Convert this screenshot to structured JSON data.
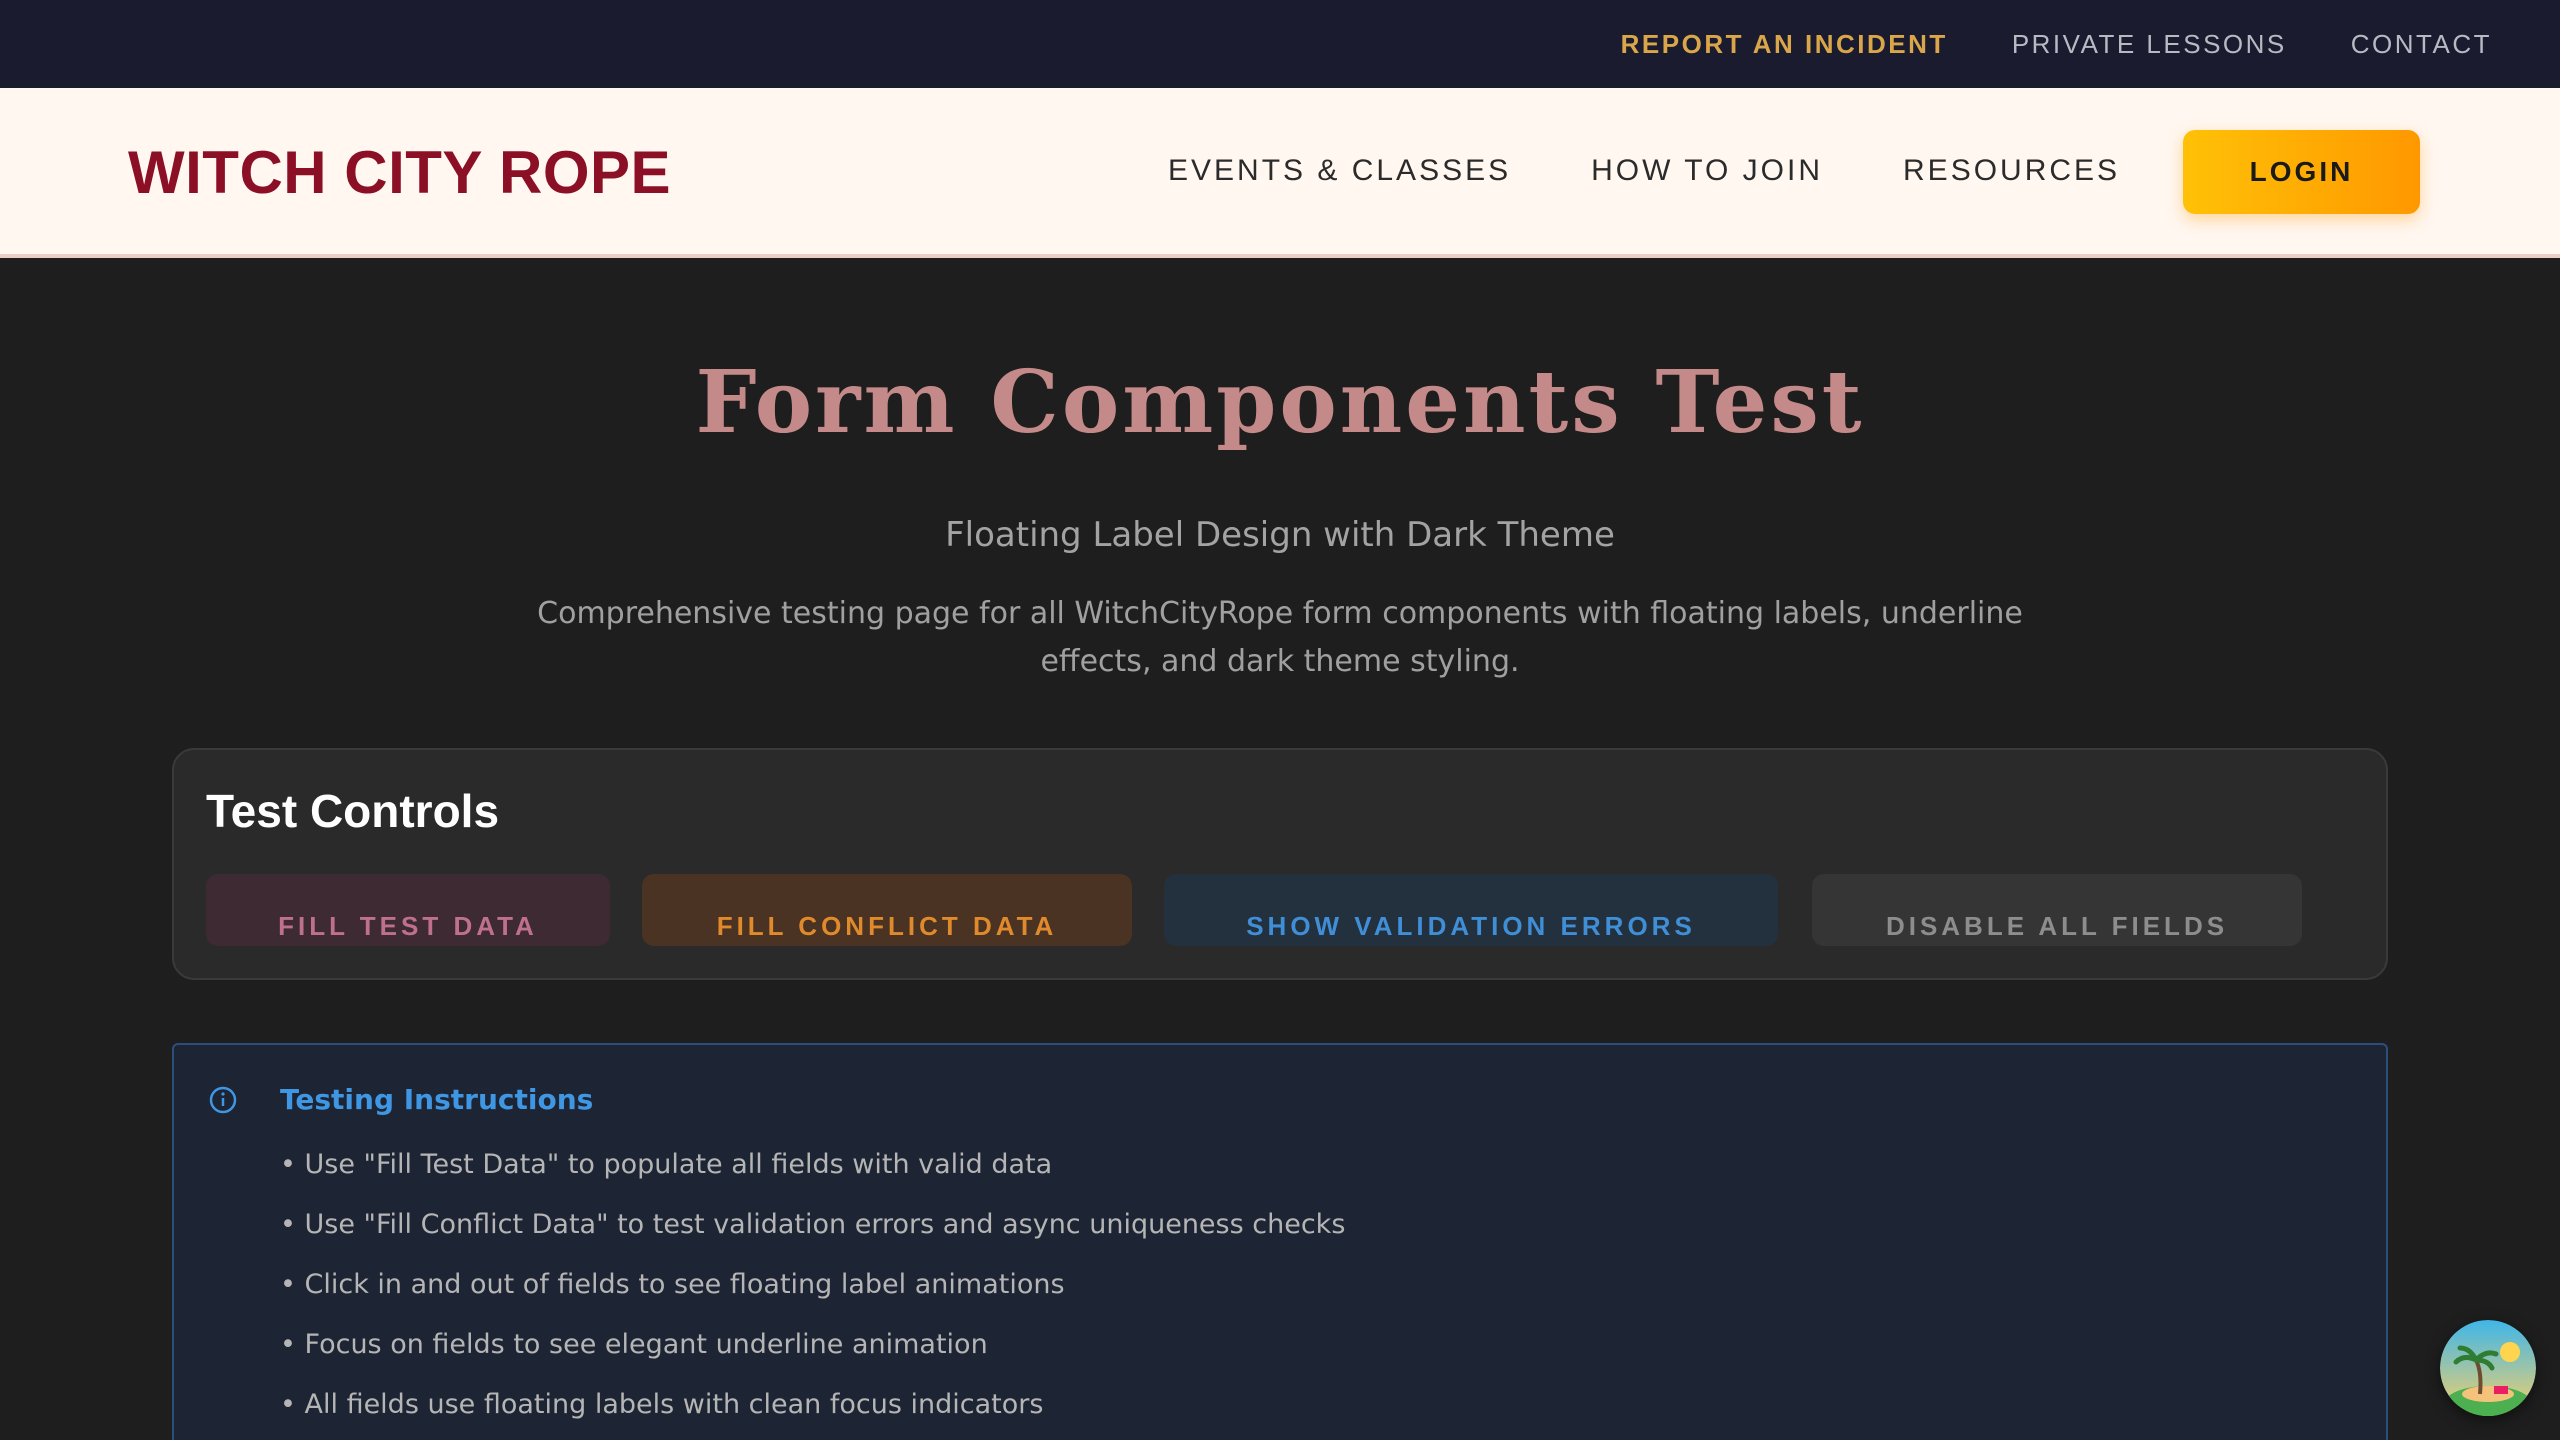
{
  "utility_nav": {
    "incident": "REPORT AN INCIDENT",
    "lessons": "PRIVATE LESSONS",
    "contact": "CONTACT"
  },
  "header": {
    "logo": "WITCH CITY ROPE",
    "nav": [
      "EVENTS & CLASSES",
      "HOW TO JOIN",
      "RESOURCES"
    ],
    "login": "LOGIN"
  },
  "hero": {
    "title": "Form Components Test",
    "subtitle": "Floating Label Design with Dark Theme",
    "description": "Comprehensive testing page for all WitchCityRope form components with floating labels, underline effects, and dark theme styling."
  },
  "controls": {
    "title": "Test Controls",
    "buttons": [
      "FILL TEST DATA",
      "FILL CONFLICT DATA",
      "SHOW VALIDATION ERRORS",
      "DISABLE ALL FIELDS"
    ]
  },
  "instructions": {
    "icon": "info-circle-icon",
    "title": "Testing Instructions",
    "items": [
      "• Use \"Fill Test Data\" to populate all fields with valid data",
      "• Use \"Fill Conflict Data\" to test validation errors and async uniqueness checks",
      "• Click in and out of fields to see floating label animations",
      "• Focus on fields to see elegant underline animation",
      "• All fields use floating labels with clean focus indicators"
    ]
  },
  "colors": {
    "utility_bg": "#1a1b2e",
    "header_bg": "#fff7f0",
    "brand": "#8b1026",
    "accent": "#ffc107",
    "title": "#c48a89",
    "info": "#3f97e4"
  }
}
